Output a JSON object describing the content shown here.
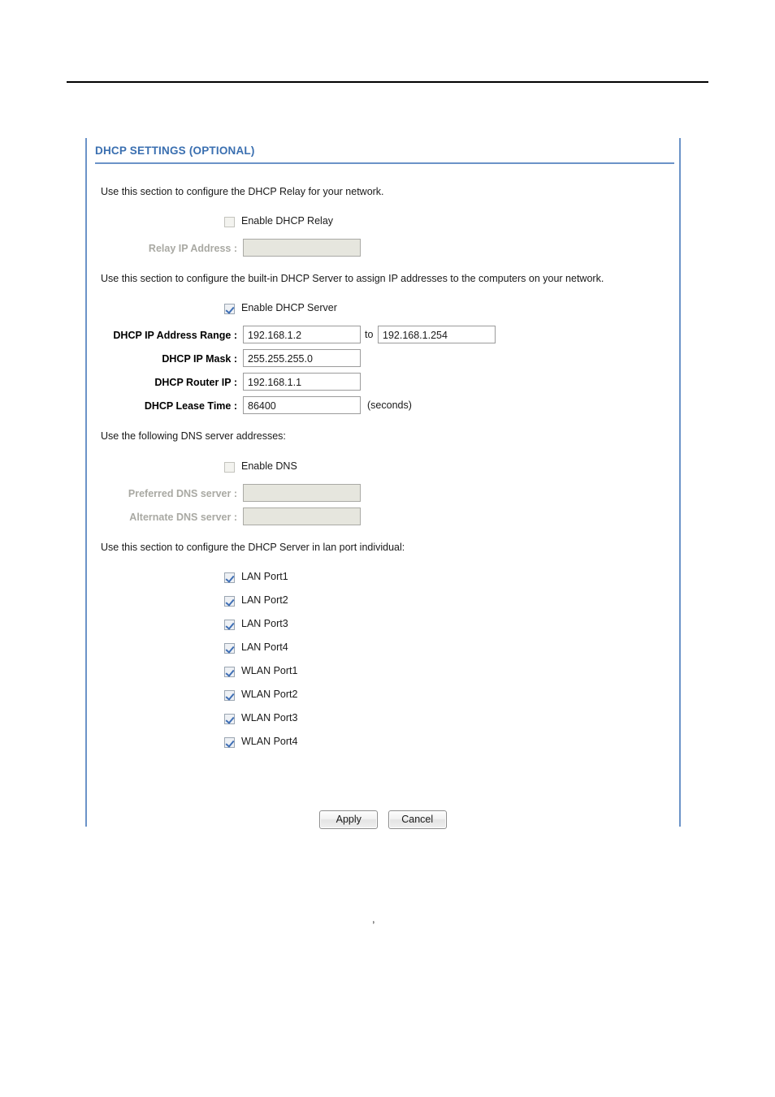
{
  "panel": {
    "title": "DHCP SETTINGS (OPTIONAL)",
    "accent_color": "#3a6fb0",
    "border_color": "#6b93c8"
  },
  "relay_section": {
    "description": "Use this section to configure the DHCP Relay for your network.",
    "enable_relay": {
      "label": "Enable DHCP Relay",
      "checked": false
    },
    "relay_ip": {
      "label": "Relay IP Address :",
      "value": "",
      "disabled": true
    }
  },
  "server_section": {
    "description": "Use this section to configure the built-in DHCP Server to assign IP addresses to the computers on your network.",
    "enable_server": {
      "label": "Enable DHCP Server",
      "checked": true
    },
    "ip_range": {
      "label": "DHCP IP Address Range :",
      "start_value": "192.168.1.2",
      "separator": "to",
      "end_value": "192.168.1.254"
    },
    "ip_mask": {
      "label": "DHCP IP Mask :",
      "value": "255.255.255.0"
    },
    "router_ip": {
      "label": "DHCP Router IP :",
      "value": "192.168.1.1"
    },
    "lease_time": {
      "label": "DHCP Lease Time :",
      "value": "86400",
      "suffix": "(seconds)"
    }
  },
  "dns_section": {
    "description": "Use the following DNS server addresses:",
    "enable_dns": {
      "label": "Enable DNS",
      "checked": false
    },
    "preferred_dns": {
      "label": "Preferred DNS server :",
      "value": "",
      "disabled": true
    },
    "alternate_dns": {
      "label": "Alternate DNS server :",
      "value": "",
      "disabled": true
    }
  },
  "ports_section": {
    "description": "Use this section to configure the DHCP Server in lan port individual:",
    "ports": [
      {
        "label": "LAN Port1",
        "checked": true
      },
      {
        "label": "LAN Port2",
        "checked": true
      },
      {
        "label": "LAN Port3",
        "checked": true
      },
      {
        "label": "LAN Port4",
        "checked": true
      },
      {
        "label": "WLAN Port1",
        "checked": true
      },
      {
        "label": "WLAN Port2",
        "checked": true
      },
      {
        "label": "WLAN Port3",
        "checked": true
      },
      {
        "label": "WLAN Port4",
        "checked": true
      }
    ]
  },
  "buttons": {
    "apply": "Apply",
    "cancel": "Cancel"
  },
  "artifact": {
    "mark": ","
  }
}
